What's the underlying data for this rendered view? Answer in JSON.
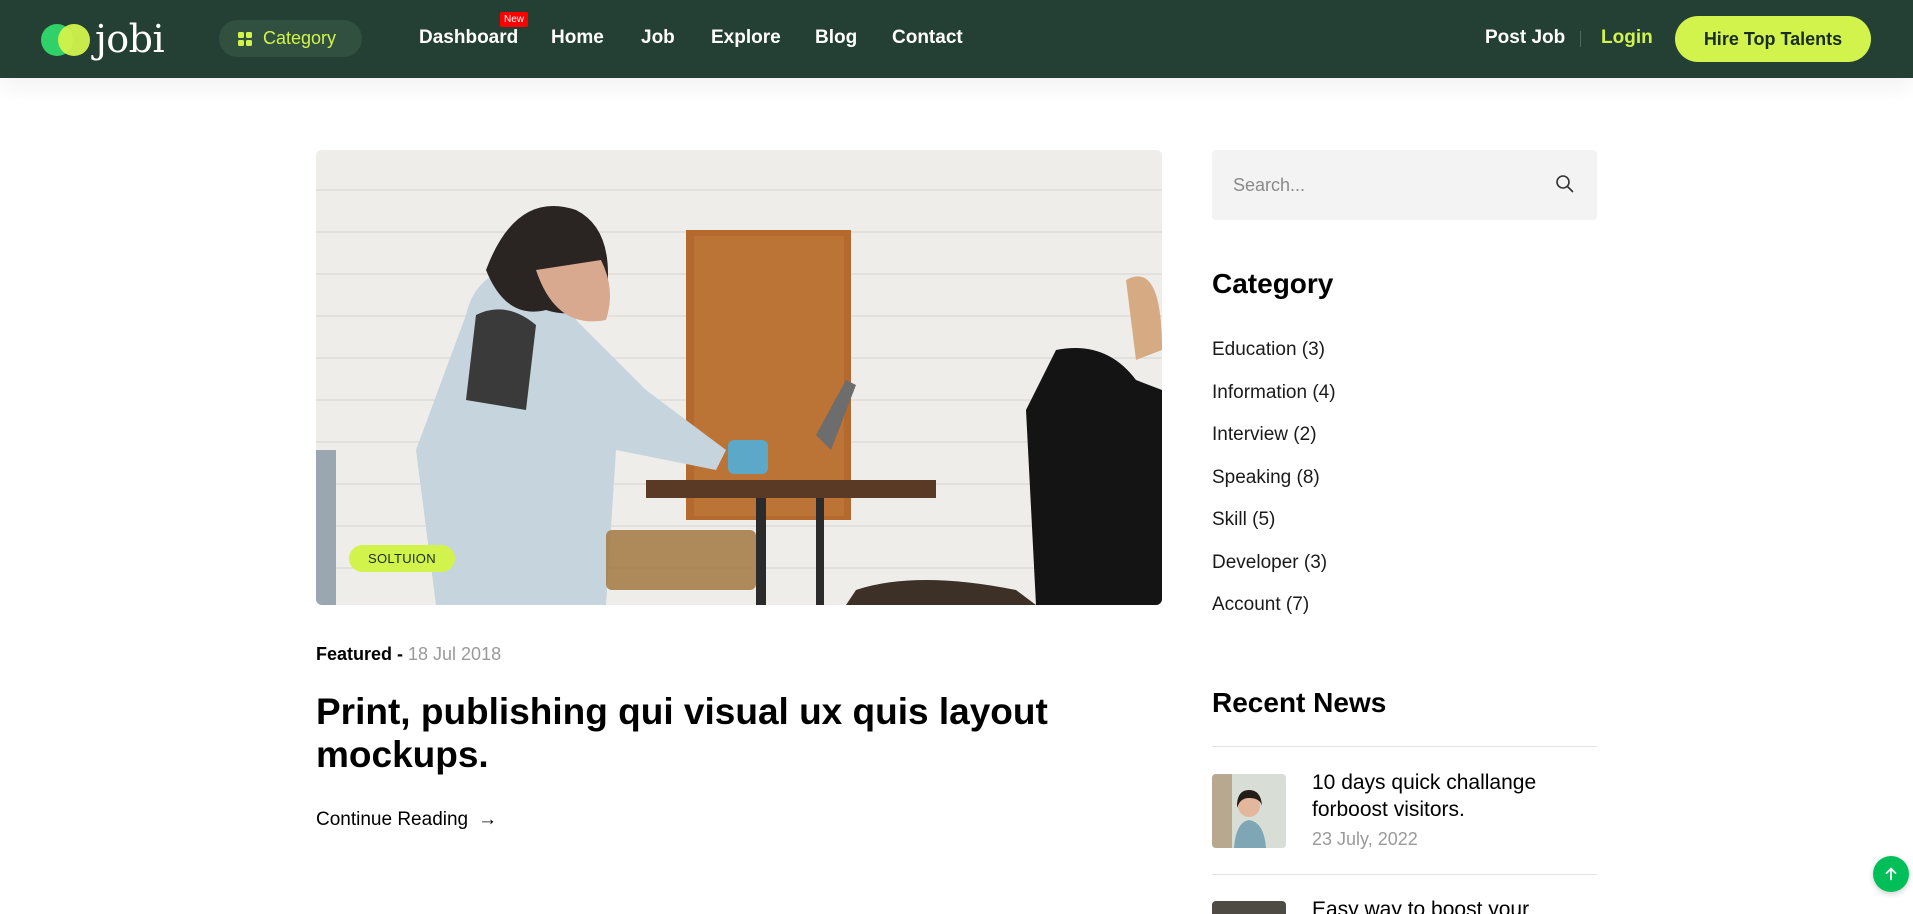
{
  "brand": {
    "name": "jobi"
  },
  "header": {
    "category_button": "Category",
    "nav": [
      {
        "label": "Dashboard",
        "badge": "New"
      },
      {
        "label": "Home"
      },
      {
        "label": "Job"
      },
      {
        "label": "Explore"
      },
      {
        "label": "Blog"
      },
      {
        "label": "Contact"
      }
    ],
    "post_job": "Post Job",
    "login": "Login",
    "hire_button": "Hire Top Talents"
  },
  "post": {
    "tag": "SOLTUION",
    "featured": "Featured - ",
    "date": "18 Jul 2018",
    "title": "Print, publishing qui visual ux quis layout mockups.",
    "continue": "Continue Reading"
  },
  "sidebar": {
    "search_placeholder": "Search...",
    "category_heading": "Category",
    "categories": [
      "Education (3)",
      "Information (4)",
      "Interview (2)",
      "Speaking (8)",
      "Skill (5)",
      "Developer (3)",
      "Account (7)"
    ],
    "recent_heading": "Recent News",
    "recent_news": [
      {
        "title": "10 days quick challange forboost visitors.",
        "date": "23 July, 2022"
      },
      {
        "title": "Easy way to boost your"
      }
    ]
  },
  "colors": {
    "navbar": "#244034",
    "accent": "#d2f34c",
    "scroll_button": "#00bf58",
    "new_badge": "#ff0000"
  },
  "icons": [
    "category-grid-icon",
    "search-icon",
    "arrow-right-icon",
    "arrow-up-icon"
  ]
}
